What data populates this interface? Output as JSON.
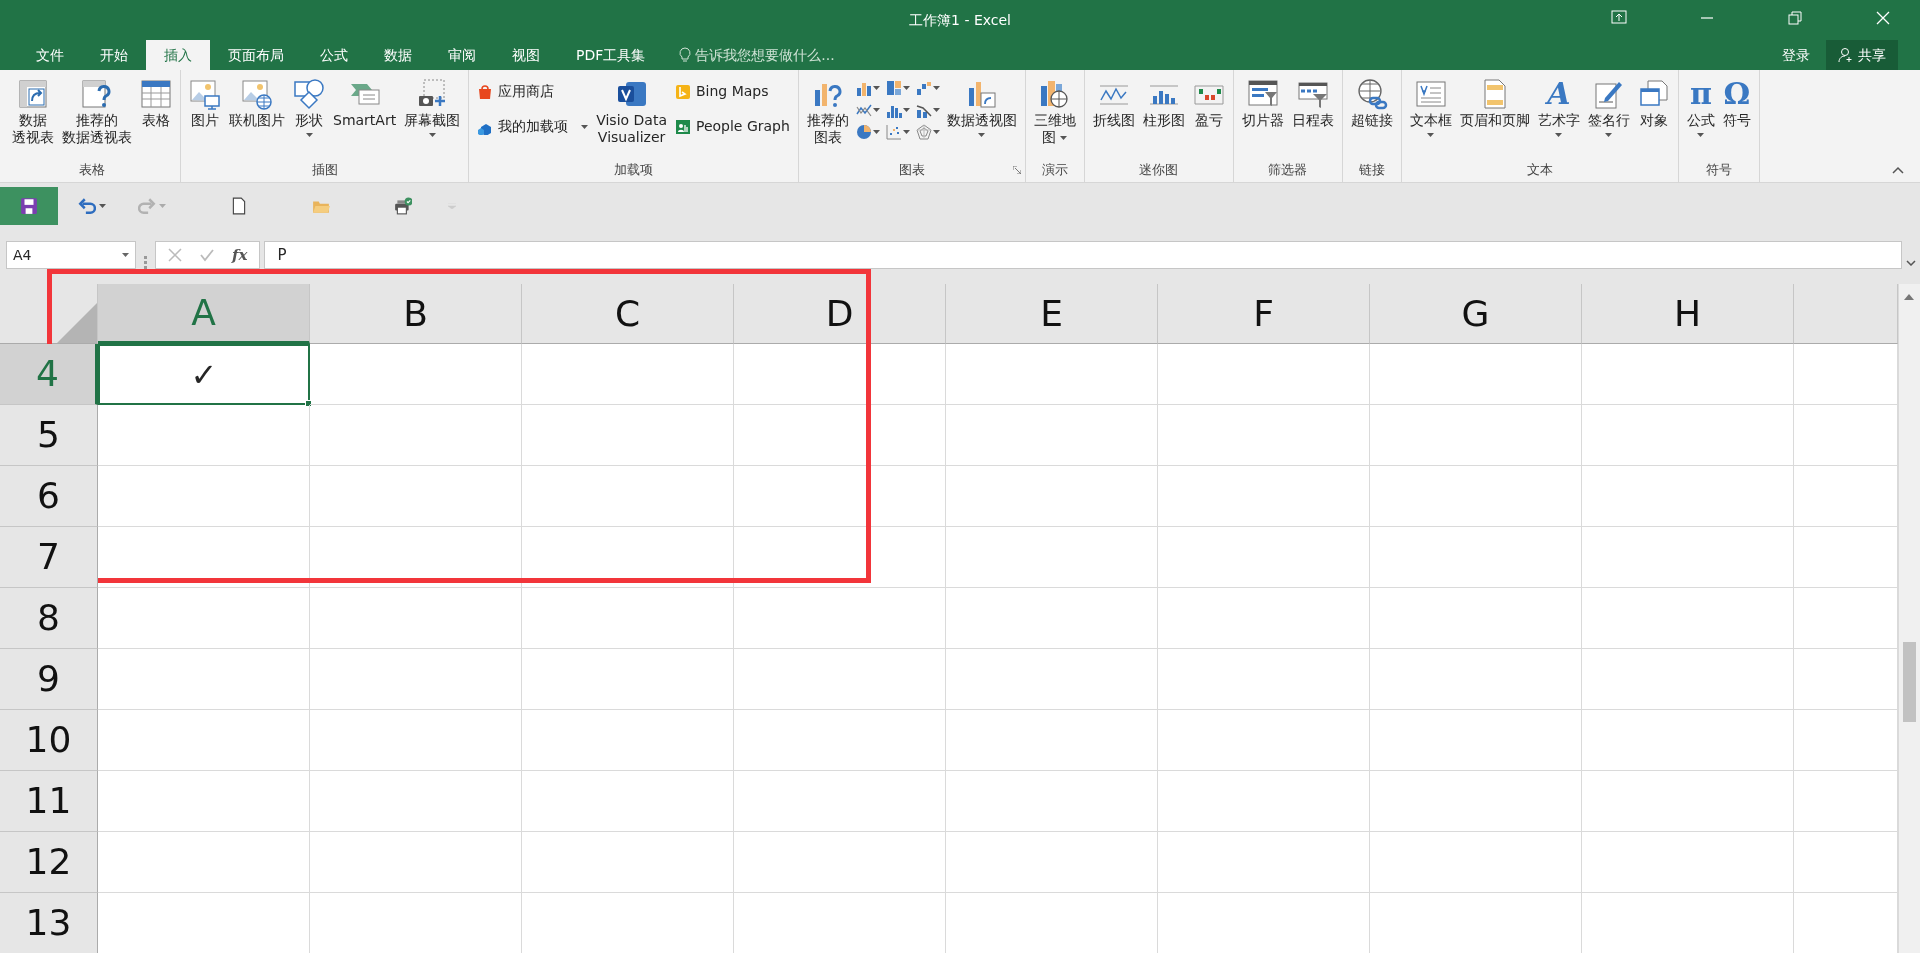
{
  "window": {
    "title": "工作簿1 - Excel",
    "sign_in": "登录",
    "share": "共享"
  },
  "tabs": [
    {
      "label": "文件",
      "selected": false
    },
    {
      "label": "开始",
      "selected": false
    },
    {
      "label": "插入",
      "selected": true
    },
    {
      "label": "页面布局",
      "selected": false
    },
    {
      "label": "公式",
      "selected": false
    },
    {
      "label": "数据",
      "selected": false
    },
    {
      "label": "审阅",
      "selected": false
    },
    {
      "label": "视图",
      "selected": false
    },
    {
      "label": "PDF工具集",
      "selected": false
    }
  ],
  "tell_me": {
    "placeholder": "告诉我您想要做什么..."
  },
  "ribbon": {
    "groups": [
      {
        "label": "表格",
        "launcher": false,
        "items": [
          {
            "kind": "large",
            "lines": [
              "数据",
              "透视表"
            ],
            "dropdown": false
          },
          {
            "kind": "large",
            "lines": [
              "推荐的",
              "数据透视表"
            ],
            "dropdown": false
          },
          {
            "kind": "large",
            "lines": [
              "表格"
            ],
            "dropdown": false
          }
        ]
      },
      {
        "label": "插图",
        "launcher": false,
        "items": [
          {
            "kind": "large",
            "lines": [
              "图片"
            ],
            "dropdown": false
          },
          {
            "kind": "large",
            "lines": [
              "联机图片"
            ],
            "dropdown": false
          },
          {
            "kind": "large",
            "lines": [
              "形状"
            ],
            "dropdown": true
          },
          {
            "kind": "large",
            "lines": [
              "SmartArt"
            ],
            "dropdown": false
          },
          {
            "kind": "large",
            "lines": [
              "屏幕截图"
            ],
            "dropdown": true
          }
        ]
      },
      {
        "label": "加载项",
        "launcher": false,
        "items": [
          {
            "kind": "stack",
            "items": [
              {
                "label": "应用商店",
                "dropdown": false
              },
              {
                "label": "我的加载项",
                "dropdown": true
              }
            ]
          },
          {
            "kind": "large",
            "lines": [
              "Visio Data",
              "Visualizer"
            ],
            "dropdown": false
          },
          {
            "kind": "stack",
            "items": [
              {
                "label": "Bing Maps",
                "dropdown": false
              },
              {
                "label": "People Graph",
                "dropdown": false
              }
            ]
          }
        ]
      },
      {
        "label": "图表",
        "launcher": true,
        "items": [
          {
            "kind": "large",
            "lines": [
              "推荐的",
              "图表"
            ],
            "dropdown": false
          },
          {
            "kind": "gallery"
          },
          {
            "kind": "large",
            "lines": [
              "数据透视图"
            ],
            "dropdown": true
          }
        ]
      },
      {
        "label": "演示",
        "launcher": false,
        "items": [
          {
            "kind": "large",
            "lines": [
              "三维地",
              "图"
            ],
            "dropdown": true
          }
        ]
      },
      {
        "label": "迷你图",
        "launcher": false,
        "items": [
          {
            "kind": "large",
            "lines": [
              "折线图"
            ],
            "dropdown": false
          },
          {
            "kind": "large",
            "lines": [
              "柱形图"
            ],
            "dropdown": false
          },
          {
            "kind": "large",
            "lines": [
              "盈亏"
            ],
            "dropdown": false
          }
        ]
      },
      {
        "label": "筛选器",
        "launcher": false,
        "items": [
          {
            "kind": "large",
            "lines": [
              "切片器"
            ],
            "dropdown": false
          },
          {
            "kind": "large",
            "lines": [
              "日程表"
            ],
            "dropdown": false
          }
        ]
      },
      {
        "label": "链接",
        "launcher": false,
        "items": [
          {
            "kind": "large",
            "lines": [
              "超链接"
            ],
            "dropdown": false
          }
        ]
      },
      {
        "label": "文本",
        "launcher": false,
        "items": [
          {
            "kind": "large",
            "lines": [
              "文本框"
            ],
            "dropdown": true
          },
          {
            "kind": "large",
            "lines": [
              "页眉和页脚"
            ],
            "dropdown": false
          },
          {
            "kind": "large",
            "glyph": "A",
            "lines": [
              "艺术字"
            ],
            "dropdown": true
          },
          {
            "kind": "large",
            "lines": [
              "签名行"
            ],
            "dropdown": true
          },
          {
            "kind": "large",
            "lines": [
              "对象"
            ],
            "dropdown": false
          }
        ]
      },
      {
        "label": "符号",
        "launcher": false,
        "items": [
          {
            "kind": "large",
            "glyph": "π",
            "lines": [
              "公式"
            ],
            "dropdown": true
          },
          {
            "kind": "large",
            "glyph": "Ω",
            "lines": [
              "符号"
            ],
            "dropdown": false
          }
        ]
      }
    ]
  },
  "quick_access": [
    {
      "kind": "save",
      "disabled": false,
      "dropdown": false
    },
    {
      "kind": "undo",
      "disabled": false,
      "dropdown": true
    },
    {
      "kind": "redo",
      "disabled": true,
      "dropdown": true
    },
    {
      "kind": "new",
      "disabled": false,
      "dropdown": false
    },
    {
      "kind": "open",
      "disabled": false,
      "dropdown": false
    },
    {
      "kind": "print",
      "disabled": false,
      "dropdown": false
    }
  ],
  "formula_bar": {
    "name_box": "A4",
    "function_label": "fx",
    "value": "P"
  },
  "sheet": {
    "columns": [
      {
        "label": "A",
        "selected": true
      },
      {
        "label": "B",
        "selected": false
      },
      {
        "label": "C",
        "selected": false
      },
      {
        "label": "D",
        "selected": false
      },
      {
        "label": "E",
        "selected": false
      },
      {
        "label": "F",
        "selected": false
      },
      {
        "label": "G",
        "selected": false
      },
      {
        "label": "H",
        "selected": false
      }
    ],
    "rows": [
      {
        "label": "4",
        "selected": true,
        "cells": [
          {
            "value": "✓",
            "selected": true
          }
        ]
      },
      {
        "label": "5",
        "selected": false
      },
      {
        "label": "6",
        "selected": false
      },
      {
        "label": "7",
        "selected": false
      },
      {
        "label": "8",
        "selected": false
      },
      {
        "label": "9",
        "selected": false
      },
      {
        "label": "10",
        "selected": false
      },
      {
        "label": "11",
        "selected": false
      },
      {
        "label": "12",
        "selected": false
      },
      {
        "label": "13",
        "selected": false
      }
    ]
  }
}
